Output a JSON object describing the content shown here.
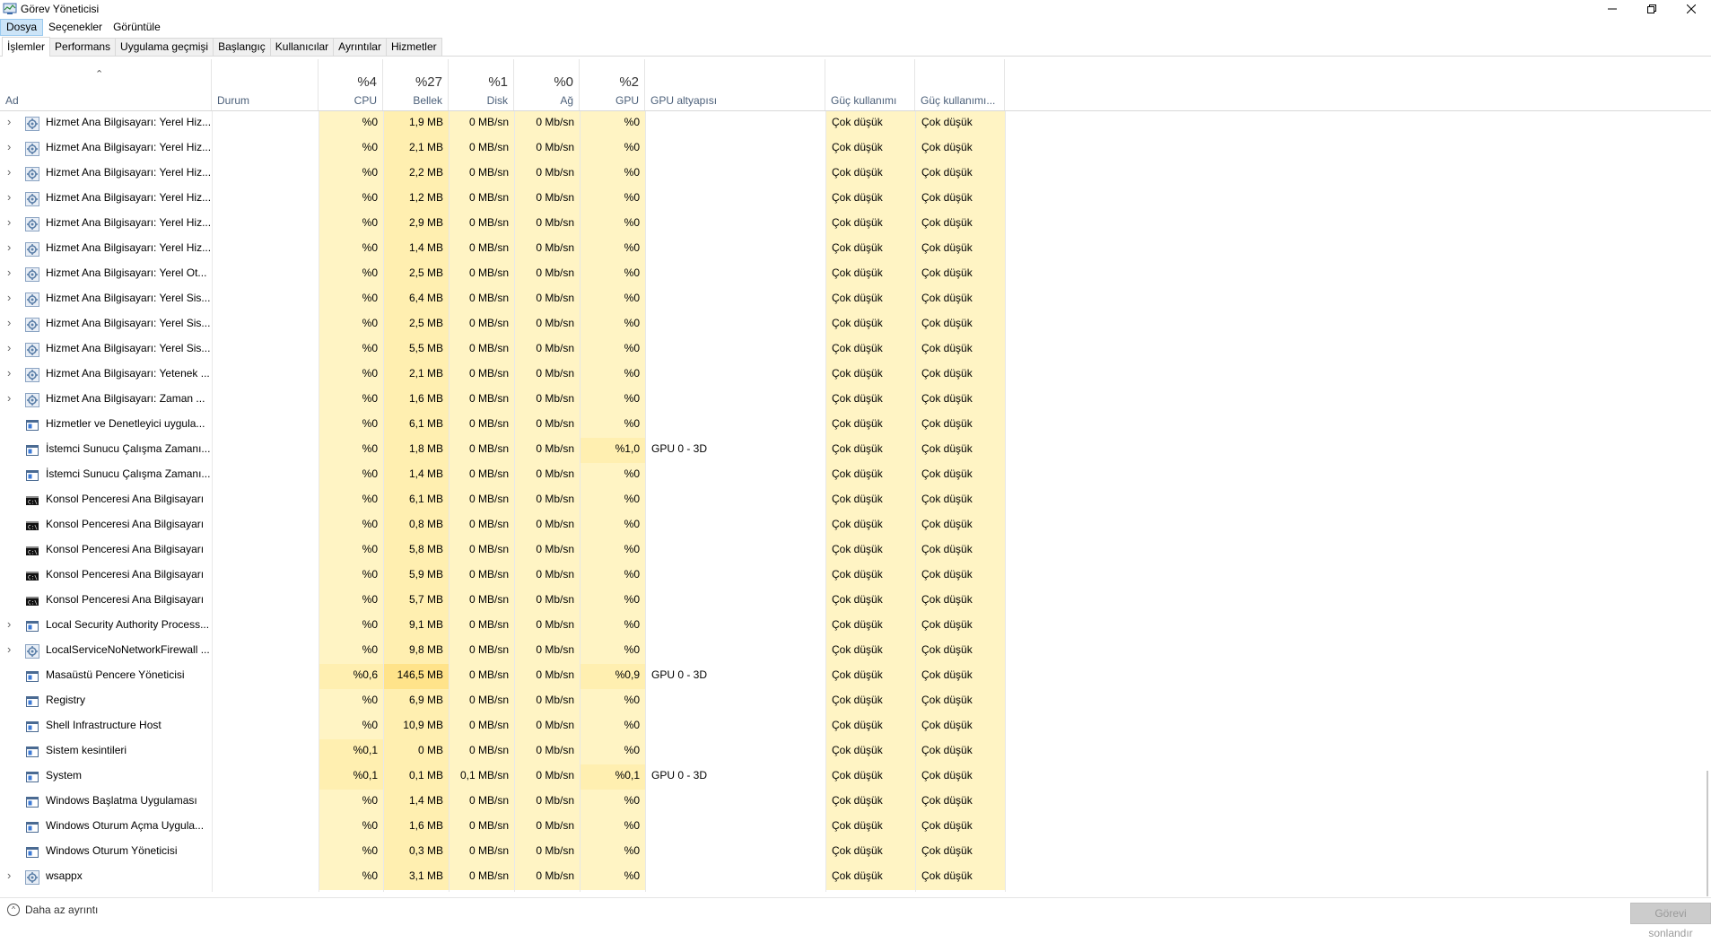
{
  "window": {
    "title": "Görev Yöneticisi"
  },
  "menu": [
    "Dosya",
    "Seçenekler",
    "Görüntüle"
  ],
  "tabs": [
    "İşlemler",
    "Performans",
    "Uygulama geçmişi",
    "Başlangıç",
    "Kullanıcılar",
    "Ayrıntılar",
    "Hizmetler"
  ],
  "columns": {
    "name": "Ad",
    "status": "Durum",
    "cpu": {
      "pct": "%4",
      "label": "CPU"
    },
    "mem": {
      "pct": "%27",
      "label": "Bellek"
    },
    "disk": {
      "pct": "%1",
      "label": "Disk"
    },
    "net": {
      "pct": "%0",
      "label": "Ağ"
    },
    "gpu": {
      "pct": "%2",
      "label": "GPU"
    },
    "gpu_engine": "GPU altyapısı",
    "power": "Güç kullanımı",
    "power_trend": "Güç kullanımı..."
  },
  "rows": [
    {
      "expand": true,
      "icon": "gear",
      "name": "Hizmet Ana Bilgisayarı: Yerel Hiz...",
      "cpu": "%0",
      "mem": "1,9 MB",
      "disk": "0 MB/sn",
      "net": "0 Mb/sn",
      "gpu": "%0",
      "gpu_engine": "",
      "power": "Çok düşük",
      "power_trend": "Çok düşük"
    },
    {
      "expand": true,
      "icon": "gear",
      "name": "Hizmet Ana Bilgisayarı: Yerel Hiz...",
      "cpu": "%0",
      "mem": "2,1 MB",
      "disk": "0 MB/sn",
      "net": "0 Mb/sn",
      "gpu": "%0",
      "gpu_engine": "",
      "power": "Çok düşük",
      "power_trend": "Çok düşük"
    },
    {
      "expand": true,
      "icon": "gear",
      "name": "Hizmet Ana Bilgisayarı: Yerel Hiz...",
      "cpu": "%0",
      "mem": "2,2 MB",
      "disk": "0 MB/sn",
      "net": "0 Mb/sn",
      "gpu": "%0",
      "gpu_engine": "",
      "power": "Çok düşük",
      "power_trend": "Çok düşük"
    },
    {
      "expand": true,
      "icon": "gear",
      "name": "Hizmet Ana Bilgisayarı: Yerel Hiz...",
      "cpu": "%0",
      "mem": "1,2 MB",
      "disk": "0 MB/sn",
      "net": "0 Mb/sn",
      "gpu": "%0",
      "gpu_engine": "",
      "power": "Çok düşük",
      "power_trend": "Çok düşük"
    },
    {
      "expand": true,
      "icon": "gear",
      "name": "Hizmet Ana Bilgisayarı: Yerel Hiz...",
      "cpu": "%0",
      "mem": "2,9 MB",
      "disk": "0 MB/sn",
      "net": "0 Mb/sn",
      "gpu": "%0",
      "gpu_engine": "",
      "power": "Çok düşük",
      "power_trend": "Çok düşük"
    },
    {
      "expand": true,
      "icon": "gear",
      "name": "Hizmet Ana Bilgisayarı: Yerel Hiz...",
      "cpu": "%0",
      "mem": "1,4 MB",
      "disk": "0 MB/sn",
      "net": "0 Mb/sn",
      "gpu": "%0",
      "gpu_engine": "",
      "power": "Çok düşük",
      "power_trend": "Çok düşük"
    },
    {
      "expand": true,
      "icon": "gear",
      "name": "Hizmet Ana Bilgisayarı: Yerel Ot...",
      "cpu": "%0",
      "mem": "2,5 MB",
      "disk": "0 MB/sn",
      "net": "0 Mb/sn",
      "gpu": "%0",
      "gpu_engine": "",
      "power": "Çok düşük",
      "power_trend": "Çok düşük"
    },
    {
      "expand": true,
      "icon": "gear",
      "name": "Hizmet Ana Bilgisayarı: Yerel Sis...",
      "cpu": "%0",
      "mem": "6,4 MB",
      "disk": "0 MB/sn",
      "net": "0 Mb/sn",
      "gpu": "%0",
      "gpu_engine": "",
      "power": "Çok düşük",
      "power_trend": "Çok düşük"
    },
    {
      "expand": true,
      "icon": "gear",
      "name": "Hizmet Ana Bilgisayarı: Yerel Sis...",
      "cpu": "%0",
      "mem": "2,5 MB",
      "disk": "0 MB/sn",
      "net": "0 Mb/sn",
      "gpu": "%0",
      "gpu_engine": "",
      "power": "Çok düşük",
      "power_trend": "Çok düşük"
    },
    {
      "expand": true,
      "icon": "gear",
      "name": "Hizmet Ana Bilgisayarı: Yerel Sis...",
      "cpu": "%0",
      "mem": "5,5 MB",
      "disk": "0 MB/sn",
      "net": "0 Mb/sn",
      "gpu": "%0",
      "gpu_engine": "",
      "power": "Çok düşük",
      "power_trend": "Çok düşük"
    },
    {
      "expand": true,
      "icon": "gear",
      "name": "Hizmet Ana Bilgisayarı: Yetenek ...",
      "cpu": "%0",
      "mem": "2,1 MB",
      "disk": "0 MB/sn",
      "net": "0 Mb/sn",
      "gpu": "%0",
      "gpu_engine": "",
      "power": "Çok düşük",
      "power_trend": "Çok düşük"
    },
    {
      "expand": true,
      "icon": "gear",
      "name": "Hizmet Ana Bilgisayarı: Zaman ...",
      "cpu": "%0",
      "mem": "1,6 MB",
      "disk": "0 MB/sn",
      "net": "0 Mb/sn",
      "gpu": "%0",
      "gpu_engine": "",
      "power": "Çok düşük",
      "power_trend": "Çok düşük"
    },
    {
      "expand": false,
      "icon": "window",
      "name": "Hizmetler ve Denetleyici uygula...",
      "cpu": "%0",
      "mem": "6,1 MB",
      "disk": "0 MB/sn",
      "net": "0 Mb/sn",
      "gpu": "%0",
      "gpu_engine": "",
      "power": "Çok düşük",
      "power_trend": "Çok düşük"
    },
    {
      "expand": false,
      "icon": "window",
      "name": "İstemci Sunucu Çalışma Zamanı...",
      "cpu": "%0",
      "mem": "1,8 MB",
      "disk": "0 MB/sn",
      "net": "0 Mb/sn",
      "gpu": "%1,0",
      "gpu_engine": "GPU 0 - 3D",
      "power": "Çok düşük",
      "power_trend": "Çok düşük"
    },
    {
      "expand": false,
      "icon": "window",
      "name": "İstemci Sunucu Çalışma Zamanı...",
      "cpu": "%0",
      "mem": "1,4 MB",
      "disk": "0 MB/sn",
      "net": "0 Mb/sn",
      "gpu": "%0",
      "gpu_engine": "",
      "power": "Çok düşük",
      "power_trend": "Çok düşük"
    },
    {
      "expand": false,
      "icon": "console",
      "name": "Konsol Penceresi Ana Bilgisayarı",
      "cpu": "%0",
      "mem": "6,1 MB",
      "disk": "0 MB/sn",
      "net": "0 Mb/sn",
      "gpu": "%0",
      "gpu_engine": "",
      "power": "Çok düşük",
      "power_trend": "Çok düşük"
    },
    {
      "expand": false,
      "icon": "console",
      "name": "Konsol Penceresi Ana Bilgisayarı",
      "cpu": "%0",
      "mem": "0,8 MB",
      "disk": "0 MB/sn",
      "net": "0 Mb/sn",
      "gpu": "%0",
      "gpu_engine": "",
      "power": "Çok düşük",
      "power_trend": "Çok düşük"
    },
    {
      "expand": false,
      "icon": "console",
      "name": "Konsol Penceresi Ana Bilgisayarı",
      "cpu": "%0",
      "mem": "5,8 MB",
      "disk": "0 MB/sn",
      "net": "0 Mb/sn",
      "gpu": "%0",
      "gpu_engine": "",
      "power": "Çok düşük",
      "power_trend": "Çok düşük"
    },
    {
      "expand": false,
      "icon": "console",
      "name": "Konsol Penceresi Ana Bilgisayarı",
      "cpu": "%0",
      "mem": "5,9 MB",
      "disk": "0 MB/sn",
      "net": "0 Mb/sn",
      "gpu": "%0",
      "gpu_engine": "",
      "power": "Çok düşük",
      "power_trend": "Çok düşük"
    },
    {
      "expand": false,
      "icon": "console",
      "name": "Konsol Penceresi Ana Bilgisayarı",
      "cpu": "%0",
      "mem": "5,7 MB",
      "disk": "0 MB/sn",
      "net": "0 Mb/sn",
      "gpu": "%0",
      "gpu_engine": "",
      "power": "Çok düşük",
      "power_trend": "Çok düşük"
    },
    {
      "expand": true,
      "icon": "window",
      "name": "Local Security Authority Process...",
      "cpu": "%0",
      "mem": "9,1 MB",
      "disk": "0 MB/sn",
      "net": "0 Mb/sn",
      "gpu": "%0",
      "gpu_engine": "",
      "power": "Çok düşük",
      "power_trend": "Çok düşük"
    },
    {
      "expand": true,
      "icon": "gear",
      "name": "LocalServiceNoNetworkFirewall ...",
      "cpu": "%0",
      "mem": "9,8 MB",
      "disk": "0 MB/sn",
      "net": "0 Mb/sn",
      "gpu": "%0",
      "gpu_engine": "",
      "power": "Çok düşük",
      "power_trend": "Çok düşük"
    },
    {
      "expand": false,
      "icon": "window",
      "name": "Masaüstü Pencere Yöneticisi",
      "cpu": "%0,6",
      "mem": "146,5 MB",
      "disk": "0 MB/sn",
      "net": "0 Mb/sn",
      "gpu": "%0,9",
      "gpu_engine": "GPU 0 - 3D",
      "power": "Çok düşük",
      "power_trend": "Çok düşük"
    },
    {
      "expand": false,
      "icon": "window",
      "name": "Registry",
      "cpu": "%0",
      "mem": "6,9 MB",
      "disk": "0 MB/sn",
      "net": "0 Mb/sn",
      "gpu": "%0",
      "gpu_engine": "",
      "power": "Çok düşük",
      "power_trend": "Çok düşük"
    },
    {
      "expand": false,
      "icon": "window",
      "name": "Shell Infrastructure Host",
      "cpu": "%0",
      "mem": "10,9 MB",
      "disk": "0 MB/sn",
      "net": "0 Mb/sn",
      "gpu": "%0",
      "gpu_engine": "",
      "power": "Çok düşük",
      "power_trend": "Çok düşük"
    },
    {
      "expand": false,
      "icon": "window",
      "name": "Sistem kesintileri",
      "cpu": "%0,1",
      "mem": "0 MB",
      "disk": "0 MB/sn",
      "net": "0 Mb/sn",
      "gpu": "%0",
      "gpu_engine": "",
      "power": "Çok düşük",
      "power_trend": "Çok düşük"
    },
    {
      "expand": false,
      "icon": "window",
      "name": "System",
      "cpu": "%0,1",
      "mem": "0,1 MB",
      "disk": "0,1 MB/sn",
      "net": "0 Mb/sn",
      "gpu": "%0,1",
      "gpu_engine": "GPU 0 - 3D",
      "power": "Çok düşük",
      "power_trend": "Çok düşük"
    },
    {
      "expand": false,
      "icon": "window",
      "name": "Windows Başlatma Uygulaması",
      "cpu": "%0",
      "mem": "1,4 MB",
      "disk": "0 MB/sn",
      "net": "0 Mb/sn",
      "gpu": "%0",
      "gpu_engine": "",
      "power": "Çok düşük",
      "power_trend": "Çok düşük"
    },
    {
      "expand": false,
      "icon": "window",
      "name": "Windows Oturum Açma Uygula...",
      "cpu": "%0",
      "mem": "1,6 MB",
      "disk": "0 MB/sn",
      "net": "0 Mb/sn",
      "gpu": "%0",
      "gpu_engine": "",
      "power": "Çok düşük",
      "power_trend": "Çok düşük"
    },
    {
      "expand": false,
      "icon": "window",
      "name": "Windows Oturum Yöneticisi",
      "cpu": "%0",
      "mem": "0,3 MB",
      "disk": "0 MB/sn",
      "net": "0 Mb/sn",
      "gpu": "%0",
      "gpu_engine": "",
      "power": "Çok düşük",
      "power_trend": "Çok düşük"
    },
    {
      "expand": true,
      "icon": "gear",
      "name": "wsappx",
      "cpu": "%0",
      "mem": "3,1 MB",
      "disk": "0 MB/sn",
      "net": "0 Mb/sn",
      "gpu": "%0",
      "gpu_engine": "",
      "power": "Çok düşük",
      "power_trend": "Çok düşük"
    }
  ],
  "footer": {
    "fewer_details": "Daha az ayrıntı",
    "end_task": "Görevi sonlandır"
  }
}
